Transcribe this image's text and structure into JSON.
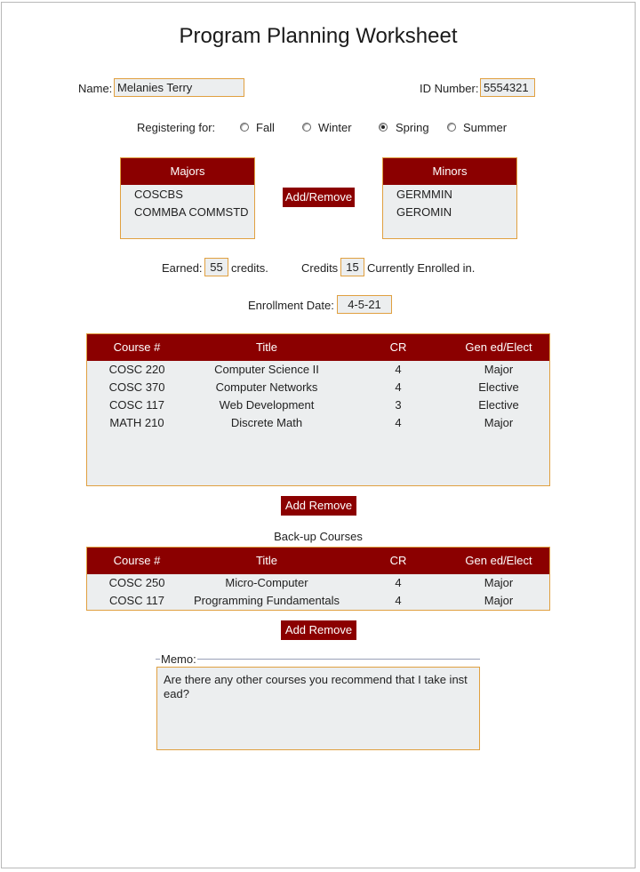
{
  "title": "Program Planning Worksheet",
  "name": {
    "label": "Name:",
    "value": "Melanies Terry"
  },
  "id": {
    "label": "ID Number:",
    "value": "5554321"
  },
  "registering": {
    "label": "Registering for:",
    "options": [
      {
        "label": "Fall",
        "selected": false
      },
      {
        "label": "Winter",
        "selected": false
      },
      {
        "label": "Spring",
        "selected": true
      },
      {
        "label": "Summer",
        "selected": false
      }
    ]
  },
  "majors": {
    "header": "Majors",
    "items": [
      "COSCBS",
      "COMMBA COMMSTD"
    ]
  },
  "minors": {
    "header": "Minors",
    "items": [
      "GERMMIN",
      "GEROMIN"
    ]
  },
  "add_remove_label": "Add/Remove",
  "credits": {
    "earned_label": "Earned:",
    "earned_value": "55",
    "earned_suffix": "credits.",
    "credits_label": "Credits",
    "credits_value": "15",
    "credits_suffix": "Currently Enrolled in."
  },
  "enrollment": {
    "label": "Enrollment Date:",
    "value": "4-5-21"
  },
  "courses": {
    "columns": [
      "Course #",
      "Title",
      "CR",
      "Gen ed/Elect"
    ],
    "rows": [
      [
        "COSC 220",
        "Computer Science II",
        "4",
        "Major"
      ],
      [
        "COSC 370",
        "Computer Networks",
        "4",
        "Elective"
      ],
      [
        "COSC 117",
        "Web Development",
        "3",
        "Elective"
      ],
      [
        "MATH 210",
        "Discrete Math",
        "4",
        "Major"
      ]
    ]
  },
  "courses_buttons": {
    "add": "Add",
    "remove": "Remove"
  },
  "backup": {
    "title": "Back-up Courses",
    "columns": [
      "Course #",
      "Title",
      "CR",
      "Gen ed/Elect"
    ],
    "rows": [
      [
        "COSC 250",
        "Micro-Computer",
        "4",
        "Major"
      ],
      [
        "COSC 117",
        "Programming Fundamentals",
        "4",
        "Major"
      ]
    ]
  },
  "backup_buttons": {
    "add": "Add",
    "remove": "Remove"
  },
  "memo": {
    "label": "Memo:",
    "value": "Are there any other courses you recommend that I take inst ead?"
  },
  "colors": {
    "accent": "#8b0000",
    "field_bg": "#eceeef",
    "field_border": "#e0a040"
  }
}
